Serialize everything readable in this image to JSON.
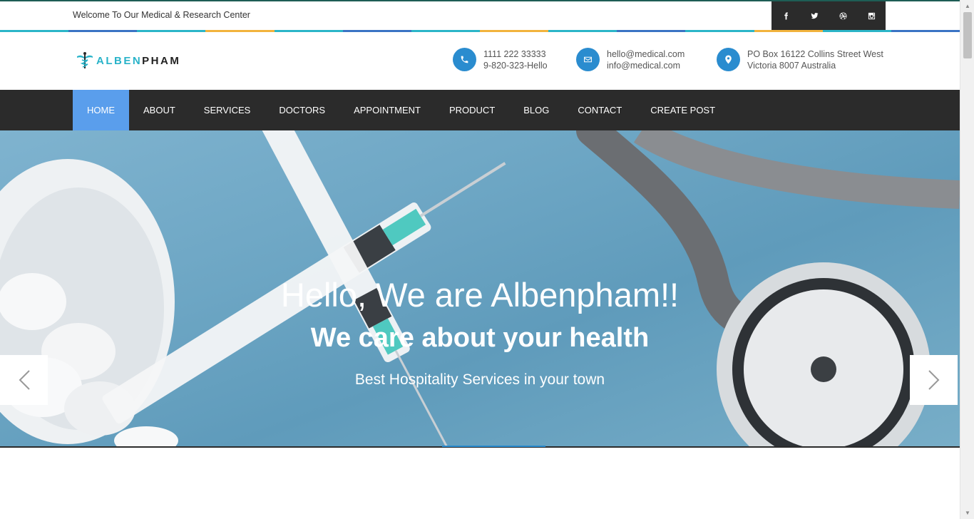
{
  "topbar": {
    "welcome": "Welcome To Our Medical & Research Center",
    "social": [
      {
        "icon": "facebook-icon"
      },
      {
        "icon": "twitter-icon"
      },
      {
        "icon": "dribbble-icon"
      },
      {
        "icon": "instagram-icon"
      }
    ]
  },
  "strip_colors": [
    "#2bb5c8",
    "#3a73c4",
    "#2bb5c8",
    "#f2b33d",
    "#2bb5c8",
    "#3a73c4",
    "#2bb5c8",
    "#f2b33d",
    "#2bb5c8",
    "#3a73c4",
    "#2bb5c8",
    "#f2b33d",
    "#2bb5c8",
    "#3a73c4"
  ],
  "logo": {
    "part1": "ALBEN",
    "part2": "PHAM"
  },
  "contacts": {
    "phone": {
      "line1": "1111 222 33333",
      "line2": "9-820-323-Hello",
      "icon": "phone-icon"
    },
    "email": {
      "line1": "hello@medical.com",
      "line2": "info@medical.com",
      "icon": "envelope-icon"
    },
    "address": {
      "line1": "PO Box 16122 Collins Street West",
      "line2": "Victoria 8007 Australia",
      "icon": "map-pin-icon"
    }
  },
  "nav": {
    "items": [
      "Home",
      "About",
      "Services",
      "Doctors",
      "Appointment",
      "Product",
      "Blog",
      "Contact",
      "Create Post"
    ],
    "active": "Home"
  },
  "hero": {
    "title": "Hello, We are Albenpham!!",
    "subtitle": "We care about your health",
    "tagline": "Best Hospitality Services in your town"
  },
  "colors": {
    "accent_blue": "#2a8ccf",
    "nav_active": "#5a9eec",
    "nav_bg": "#2b2b2b",
    "logo_accent": "#29b3c9"
  }
}
